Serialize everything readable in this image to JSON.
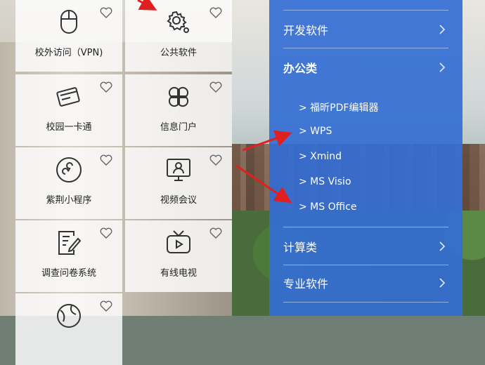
{
  "tiles": [
    {
      "label": "校外访问（VPN)",
      "icon": "mouse-icon"
    },
    {
      "label": "公共软件",
      "icon": "gear-icon"
    },
    {
      "label": "校园一卡通",
      "icon": "card-icon"
    },
    {
      "label": "信息门户",
      "icon": "clover-icon"
    },
    {
      "label": "紫荆小程序",
      "icon": "mini-program-icon"
    },
    {
      "label": "视频会议",
      "icon": "video-meeting-icon"
    },
    {
      "label": "调查问卷系统",
      "icon": "survey-icon"
    },
    {
      "label": "有线电视",
      "icon": "tv-icon"
    },
    {
      "label": "",
      "icon": "globe-icon"
    }
  ],
  "menu": {
    "items": [
      {
        "label": "开发软件"
      },
      {
        "label": "办公类"
      },
      {
        "label": "计算类"
      },
      {
        "label": "专业软件"
      }
    ],
    "subitems": [
      {
        "label": "> 福昕PDF编辑器"
      },
      {
        "label": "> WPS"
      },
      {
        "label": "> Xmind"
      },
      {
        "label": "> MS Visio"
      },
      {
        "label": "> MS Office"
      }
    ]
  },
  "colors": {
    "panel": "#346ed4",
    "arrow": "#e02020",
    "icon_stroke": "#333333"
  }
}
